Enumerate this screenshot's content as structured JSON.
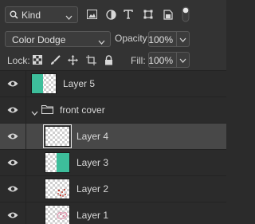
{
  "filter": {
    "kind_label": "Kind",
    "icons": [
      "search-icon",
      "image-filter-icon",
      "adjustment-filter-icon",
      "type-filter-icon",
      "shape-filter-icon",
      "smart-object-filter-icon",
      "filter-toggle"
    ]
  },
  "blend": {
    "mode": "Color Dodge",
    "opacity_label": "Opacity:",
    "opacity_value": "100%"
  },
  "lock": {
    "label": "Lock:",
    "icons": [
      "lock-transparency-icon",
      "lock-pixels-icon",
      "lock-position-icon",
      "lock-artboard-icon",
      "lock-all-icon"
    ],
    "fill_label": "Fill:",
    "fill_value": "100%"
  },
  "layers": [
    {
      "name": "Layer 5",
      "type": "layer",
      "visible": true,
      "selected": false,
      "thumb": "teal-left"
    },
    {
      "name": "front cover",
      "type": "group",
      "visible": true,
      "selected": false,
      "expanded": true
    },
    {
      "name": "Layer 4",
      "type": "layer",
      "visible": true,
      "selected": true,
      "thumb": "transparent"
    },
    {
      "name": "Layer 3",
      "type": "layer",
      "visible": true,
      "selected": false,
      "thumb": "teal-right"
    },
    {
      "name": "Layer 2",
      "type": "layer",
      "visible": true,
      "selected": false,
      "thumb": "red-art"
    },
    {
      "name": "Layer 1",
      "type": "layer",
      "visible": true,
      "selected": false,
      "thumb": "pink-art"
    }
  ],
  "colors": {
    "panel": "#333333",
    "list": "#2b2b2b",
    "selected": "#484848",
    "teal": "#3dbe9b"
  }
}
